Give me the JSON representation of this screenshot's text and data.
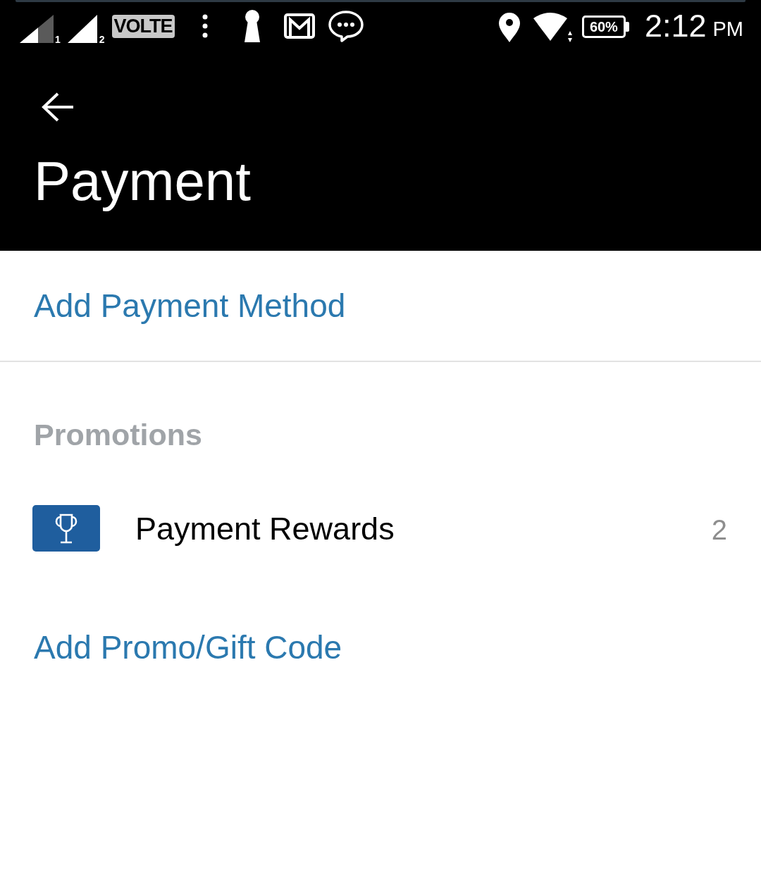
{
  "status_bar": {
    "sims": [
      {
        "label": "1"
      },
      {
        "label": "2"
      }
    ],
    "volte": "VOLTE",
    "battery": "60%",
    "time": "2:12",
    "period": "PM"
  },
  "header": {
    "title": "Payment"
  },
  "payment_methods": {
    "action": "Add Payment Method"
  },
  "promotions": {
    "heading": "Promotions",
    "items": [
      {
        "label": "Payment Rewards",
        "count": "2"
      }
    ],
    "action": "Add Promo/Gift Code"
  }
}
